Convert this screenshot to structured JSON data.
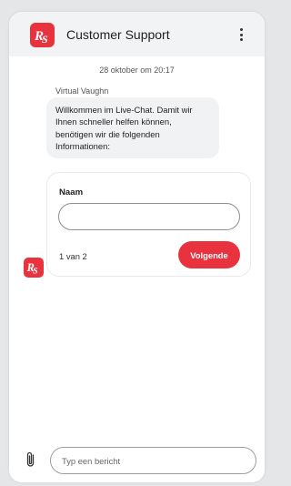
{
  "header": {
    "title": "Customer Support",
    "logo_icon": "rs-logo-icon",
    "menu_icon": "more-vertical-icon"
  },
  "chat": {
    "timestamp": "28 oktober om 20:17",
    "sender": "Virtual Vaughn",
    "message": "Willkommen im Live-Chat. Damit wir Ihnen schneller helfen können, benötigen wir die folgenden Informationen:"
  },
  "form": {
    "label": "Naam",
    "input_value": "",
    "step": "1 van 2",
    "next_label": "Volgende"
  },
  "composer": {
    "placeholder": "Typ een bericht",
    "attach_icon": "paperclip-icon"
  },
  "colors": {
    "accent": "#e8333f",
    "header_bg": "#f2f3f5",
    "bubble_bg": "#f1f2f4"
  }
}
